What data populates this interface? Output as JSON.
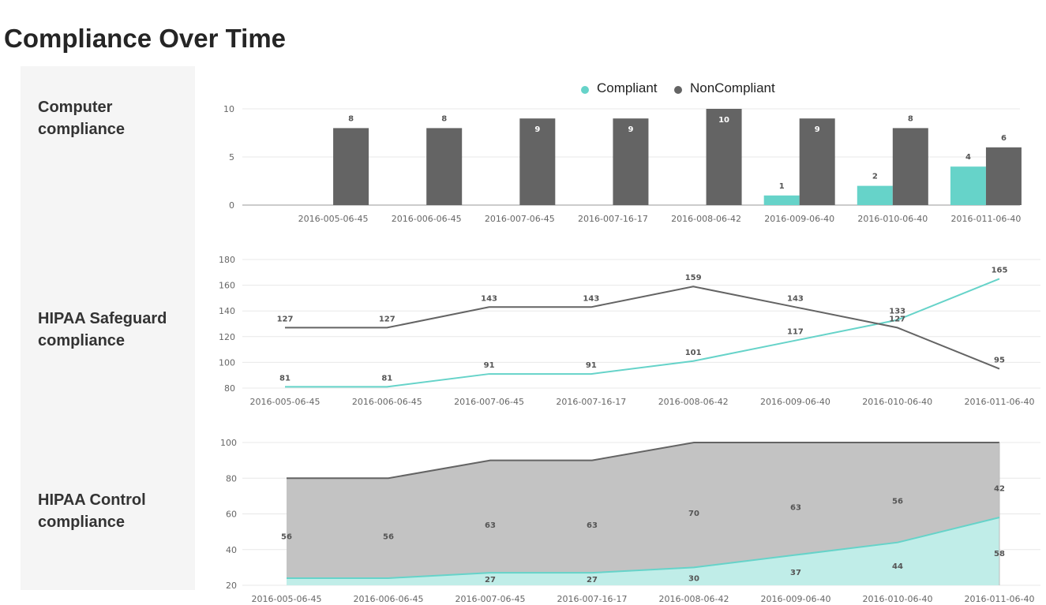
{
  "title": "Compliance Over Time",
  "sections": [
    {
      "label_line1": "Computer",
      "label_line2": "compliance"
    },
    {
      "label_line1": "HIPAA Safeguard",
      "label_line2": "compliance"
    },
    {
      "label_line1": "HIPAA Control",
      "label_line2": "compliance"
    }
  ],
  "colors": {
    "compliant": "#66d3c9",
    "noncompliant": "#646464",
    "area_noncompliant": "#c3c3c3",
    "area_compliant": "#c0ede8"
  },
  "chart_data": [
    {
      "type": "bar",
      "legend": [
        "Compliant",
        "NonCompliant"
      ],
      "legend_position": "top-center",
      "categories": [
        "2016-005-06-45",
        "2016-006-06-45",
        "2016-007-06-45",
        "2016-007-16-17",
        "2016-008-06-42",
        "2016-009-06-40",
        "2016-010-06-40",
        "2016-011-06-40"
      ],
      "series": [
        {
          "name": "Compliant",
          "values": [
            0,
            0,
            0,
            0,
            0,
            1,
            2,
            4
          ]
        },
        {
          "name": "NonCompliant",
          "values": [
            8,
            8,
            9,
            9,
            10,
            9,
            8,
            6
          ]
        }
      ],
      "ylim": [
        0,
        10
      ],
      "yticks": [
        0,
        5,
        10
      ],
      "grid": true
    },
    {
      "type": "line",
      "categories": [
        "2016-005-06-45",
        "2016-006-06-45",
        "2016-007-06-45",
        "2016-007-16-17",
        "2016-008-06-42",
        "2016-009-06-40",
        "2016-010-06-40",
        "2016-011-06-40"
      ],
      "series": [
        {
          "name": "Compliant",
          "values": [
            81,
            81,
            91,
            91,
            101,
            117,
            133,
            165
          ]
        },
        {
          "name": "NonCompliant",
          "values": [
            127,
            127,
            143,
            143,
            159,
            143,
            127,
            95
          ]
        }
      ],
      "ylim": [
        80,
        180
      ],
      "yticks": [
        80,
        100,
        120,
        140,
        160,
        180
      ],
      "grid": true
    },
    {
      "type": "area",
      "stacked": true,
      "categories": [
        "2016-005-06-45",
        "2016-006-06-45",
        "2016-007-06-45",
        "2016-007-16-17",
        "2016-008-06-42",
        "2016-009-06-40",
        "2016-010-06-40",
        "2016-011-06-40"
      ],
      "series": [
        {
          "name": "Compliant",
          "values": [
            24,
            24,
            27,
            27,
            30,
            37,
            44,
            58
          ],
          "labels": [
            "",
            "",
            "27",
            "27",
            "30",
            "37",
            "44",
            "58"
          ]
        },
        {
          "name": "NonCompliant",
          "values": [
            56,
            56,
            63,
            63,
            70,
            63,
            56,
            42
          ]
        }
      ],
      "ylim": [
        20,
        100
      ],
      "yticks": [
        20,
        40,
        60,
        80,
        100
      ],
      "grid": true
    }
  ]
}
